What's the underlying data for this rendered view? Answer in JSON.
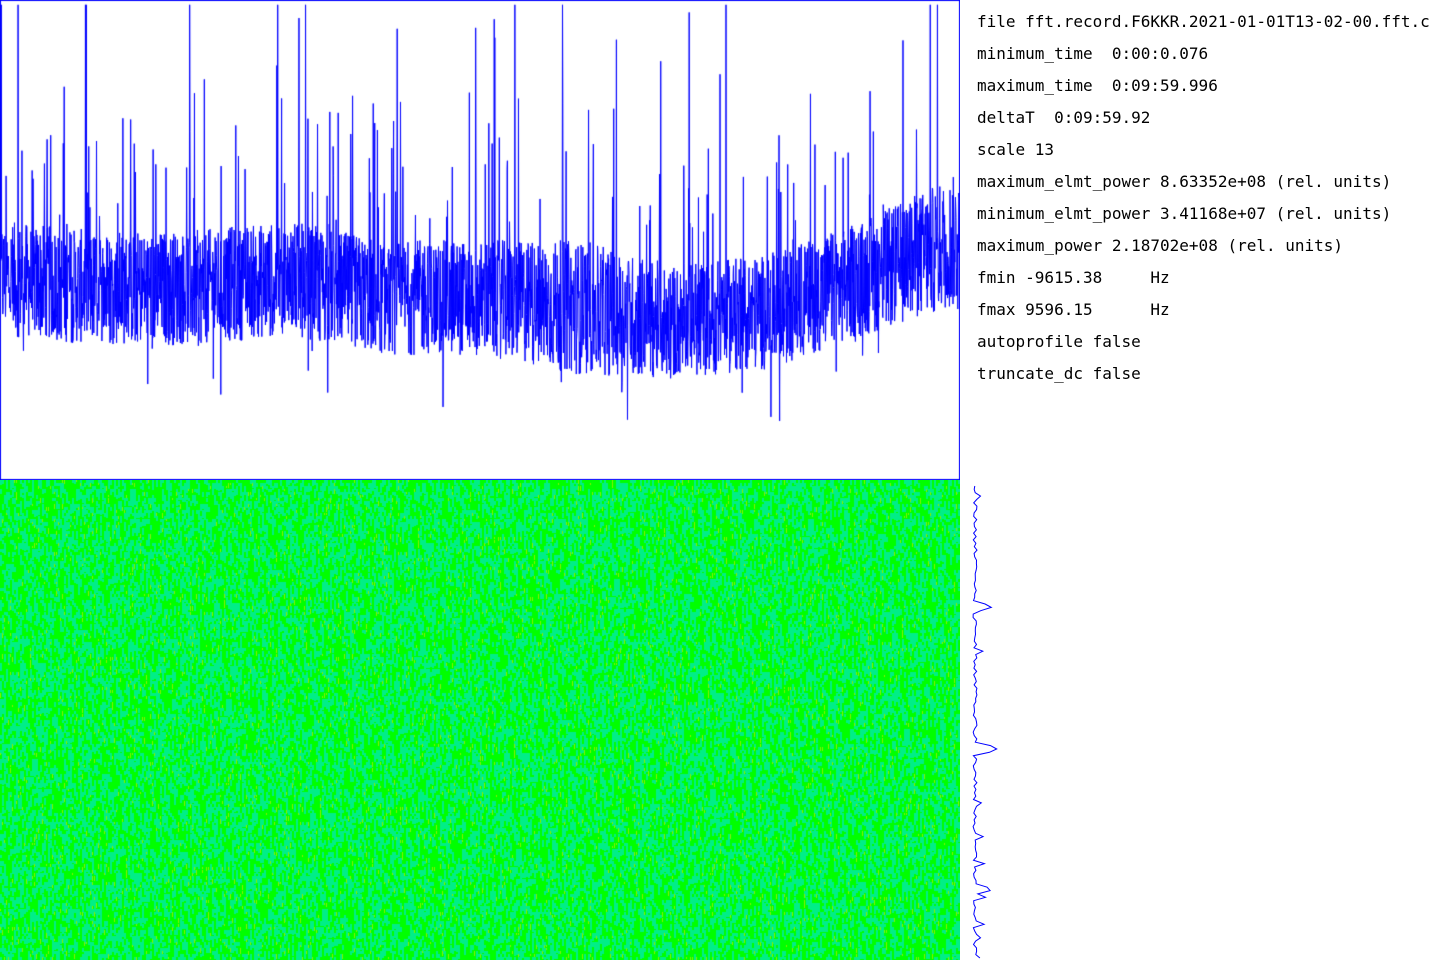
{
  "info": {
    "file": "file fft.record.F6KKR.2021-01-01T13-02-00.fft.c",
    "minimum_time": "minimum_time  0:00:0.076",
    "maximum_time": "maximum_time  0:09:59.996",
    "deltaT": "deltaT  0:09:59.92",
    "scale": "scale 13",
    "maximum_elmt_power": "maximum_elmt_power 8.63352e+08 (rel. units)",
    "minimum_elmt_power": "minimum_elmt_power 3.41168e+07 (rel. units)",
    "maximum_power": "maximum_power 2.18702e+08 (rel. units)",
    "fmin": "fmin -9615.38     Hz",
    "fmax": "fmax 9596.15      Hz",
    "autoprofile": "autoprofile false",
    "truncate_dc": "truncate_dc false"
  },
  "colors": {
    "trace": "#0000ff",
    "frame": "#0000ff",
    "spectrogram_base": "#00ff00",
    "spectrogram_alt": "#00ee88",
    "spectrogram_hot": "#88ee00",
    "background": "#ffffff"
  },
  "chart_data": [
    {
      "type": "line",
      "subject": "total power vs time",
      "x_range": [
        0.076,
        599.996
      ],
      "y_min_approx": 34116800,
      "y_max_approx": 218702000,
      "envelope": {
        "x": [
          0,
          60,
          120,
          180,
          240,
          300,
          360,
          420,
          480,
          540,
          600
        ],
        "mean": [
          0.42,
          0.4,
          0.4,
          0.42,
          0.38,
          0.38,
          0.36,
          0.33,
          0.35,
          0.42,
          0.5
        ],
        "spread": [
          0.12,
          0.12,
          0.12,
          0.12,
          0.12,
          0.12,
          0.14,
          0.12,
          0.12,
          0.12,
          0.14
        ]
      }
    },
    {
      "type": "heatmap",
      "subject": "spectrogram frequency vs time",
      "x_range": [
        0.076,
        599.996
      ],
      "y_range": [
        -9615.38,
        9596.15
      ]
    },
    {
      "type": "line",
      "subject": "frequency profile",
      "y_range": [
        -9615.38,
        9596.15
      ],
      "peaks": [
        {
          "y_fraction": 0.255,
          "level": 0.4
        },
        {
          "y_fraction": 0.555,
          "level": 0.55
        },
        {
          "y_fraction": 0.855,
          "level": 0.4
        }
      ]
    }
  ]
}
